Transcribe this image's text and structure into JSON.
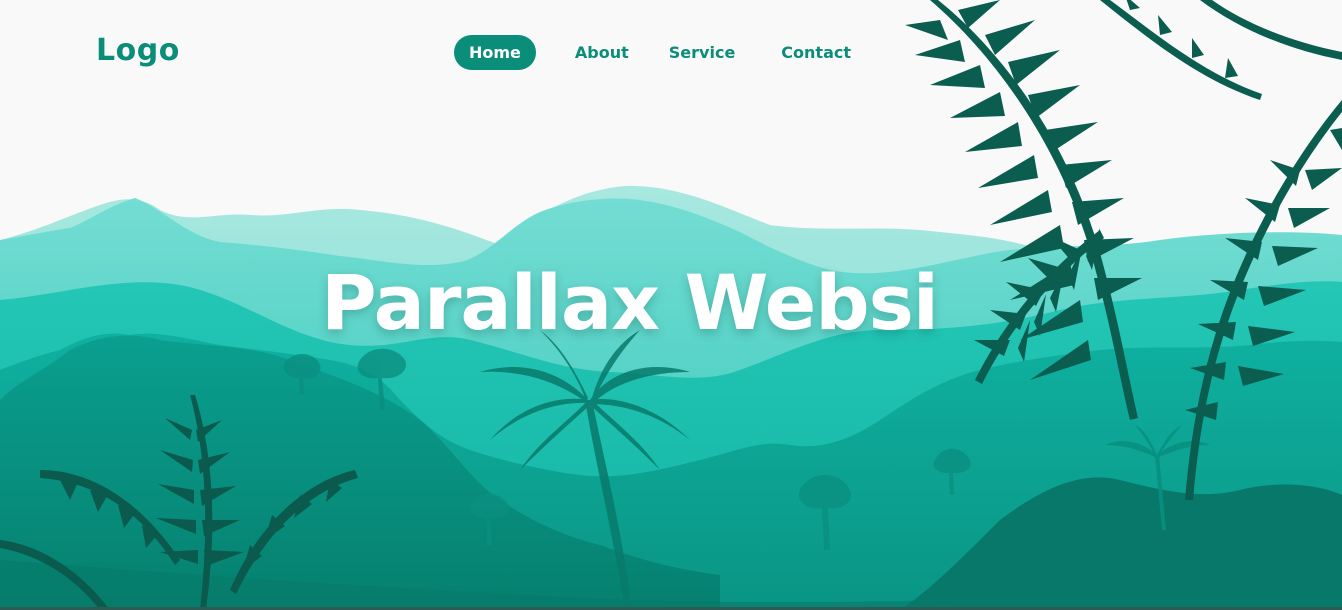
{
  "logo": {
    "text": "Logo"
  },
  "nav": {
    "items": [
      {
        "label": "Home",
        "active": true
      },
      {
        "label": "About",
        "active": false
      },
      {
        "label": "Service",
        "active": false
      },
      {
        "label": "Contact",
        "active": false
      }
    ]
  },
  "hero": {
    "title": "Parallax Websi"
  },
  "colors": {
    "accent": "#0a8d79",
    "background": "#f9f9f9",
    "far_mountains": "#a8e8e0",
    "mid_mountains": "#6fdcd2",
    "hills": "#19c0b0",
    "forest": "#0a9d8d",
    "foliage_dark": "#0a5f50"
  },
  "icons": [
    "palm-tree-icon",
    "fern-icon",
    "mountain-icon",
    "tree-icon"
  ]
}
